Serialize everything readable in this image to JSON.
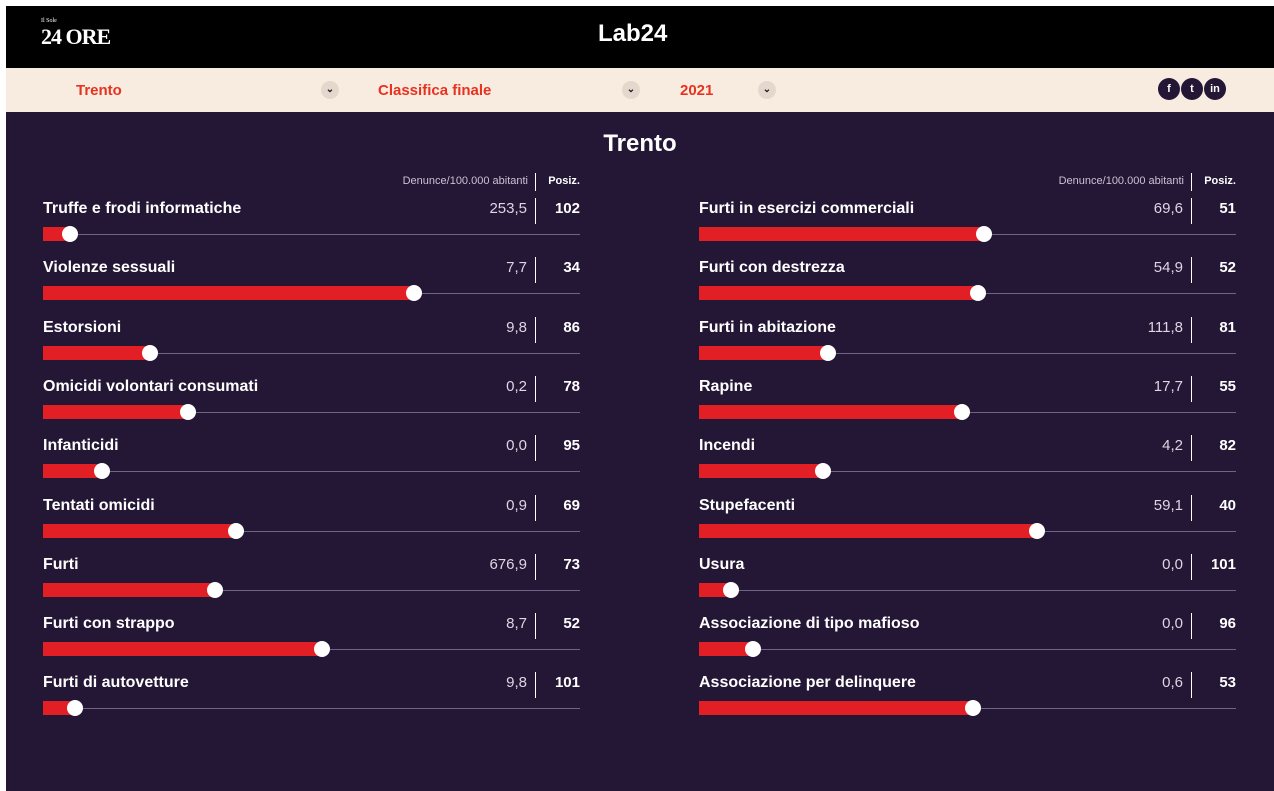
{
  "header": {
    "brand_left": "24 ORE",
    "brand_left_small": "Il Sole",
    "brand_center": "Lab24"
  },
  "filters": {
    "city": "Trento",
    "ranking": "Classifica finale",
    "year": "2021",
    "chevron_glyph": "⌄"
  },
  "social": {
    "facebook": "f",
    "twitter": "t",
    "linkedin": "in"
  },
  "page_title": "Trento",
  "column_header": {
    "metric_label": "Denunce/100.000 abitanti",
    "position_label": "Posiz."
  },
  "colors": {
    "background": "#231735",
    "bar": "#e11f25",
    "accent": "#e8321f"
  },
  "left_rows": [
    {
      "name": "Truffe e frodi informatiche",
      "value": "253,5",
      "position": "102",
      "level": 0.05
    },
    {
      "name": "Violenze sessuali",
      "value": "7,7",
      "position": "34",
      "level": 0.69
    },
    {
      "name": "Estorsioni",
      "value": "9,8",
      "position": "86",
      "level": 0.2
    },
    {
      "name": "Omicidi volontari consumati",
      "value": "0,2",
      "position": "78",
      "level": 0.27
    },
    {
      "name": "Infanticidi",
      "value": "0,0",
      "position": "95",
      "level": 0.11
    },
    {
      "name": "Tentati omicidi",
      "value": "0,9",
      "position": "69",
      "level": 0.36
    },
    {
      "name": "Furti",
      "value": "676,9",
      "position": "73",
      "level": 0.32
    },
    {
      "name": "Furti con strappo",
      "value": "8,7",
      "position": "52",
      "level": 0.52
    },
    {
      "name": "Furti di autovetture",
      "value": "9,8",
      "position": "101",
      "level": 0.06
    }
  ],
  "right_rows": [
    {
      "name": "Furti in esercizi commerciali",
      "value": "69,6",
      "position": "51",
      "level": 0.53
    },
    {
      "name": "Furti con destrezza",
      "value": "54,9",
      "position": "52",
      "level": 0.52
    },
    {
      "name": "Furti in abitazione",
      "value": "111,8",
      "position": "81",
      "level": 0.24
    },
    {
      "name": "Rapine",
      "value": "17,7",
      "position": "55",
      "level": 0.49
    },
    {
      "name": "Incendi",
      "value": "4,2",
      "position": "82",
      "level": 0.23
    },
    {
      "name": "Stupefacenti",
      "value": "59,1",
      "position": "40",
      "level": 0.63
    },
    {
      "name": "Usura",
      "value": "0,0",
      "position": "101",
      "level": 0.06
    },
    {
      "name": "Associazione di tipo mafioso",
      "value": "0,0",
      "position": "96",
      "level": 0.1
    },
    {
      "name": "Associazione per delinquere",
      "value": "0,6",
      "position": "53",
      "level": 0.51
    }
  ]
}
